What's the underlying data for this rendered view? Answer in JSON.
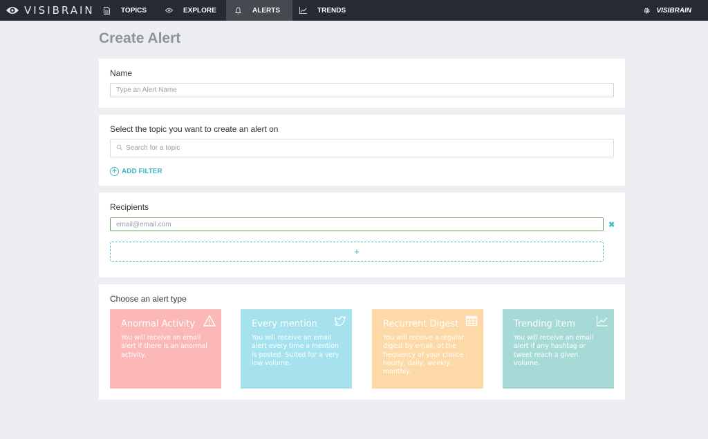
{
  "brand": {
    "name": "VISIBRAIN"
  },
  "nav": {
    "items": [
      {
        "label": "TOPICS",
        "icon": "document-icon"
      },
      {
        "label": "EXPLORE",
        "icon": "eye-icon"
      },
      {
        "label": "ALERTS",
        "icon": "bell-icon",
        "active": true
      },
      {
        "label": "TRENDS",
        "icon": "line-chart-icon"
      }
    ],
    "account": {
      "label": "VISIBRAIN",
      "icon": "gear-icon"
    }
  },
  "page": {
    "title": "Create Alert"
  },
  "name_section": {
    "label": "Name",
    "input_placeholder": "Type an Alert Name",
    "input_value": ""
  },
  "topic_section": {
    "label": "Select the topic you want to create an alert on",
    "search_placeholder": "Search for a topic",
    "search_value": "",
    "add_filter_label": "ADD FILTER"
  },
  "recipients_section": {
    "label": "Recipients",
    "email_placeholder": "email@email.com",
    "email_value": "",
    "remove_glyph": "✖",
    "add_glyph": "+"
  },
  "alert_type_section": {
    "label": "Choose an alert type",
    "types": [
      {
        "title": "Anormal Activity",
        "description": "You will receive an email alert if there is an anormal activity.",
        "icon": "warning-icon",
        "color": "#fbb8b6"
      },
      {
        "title": "Every mention",
        "description": "You will receive an email alert every time a mention is posted. Suited for a very low volume.",
        "icon": "twitter-icon",
        "color": "#a5e2ee"
      },
      {
        "title": "Recurrent Digest",
        "description": "You will receive a regular digest by email, at the frequency of your choice : hourly, daily, weekly, monthly.",
        "icon": "table-icon",
        "color": "#fcd9a6"
      },
      {
        "title": "Trending item",
        "description": "You will receive an email alert if any hashtag or tweet reach a given volume.",
        "icon": "line-chart-icon",
        "color": "#a6dad6"
      }
    ]
  }
}
